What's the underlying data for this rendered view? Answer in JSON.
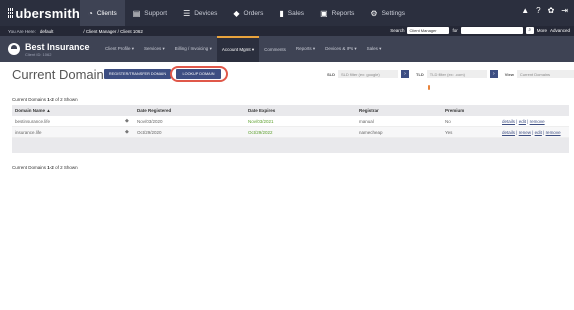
{
  "app": {
    "name": "ubersmith"
  },
  "topnav": {
    "items": [
      {
        "label": "Clients",
        "icon": "gauge-icon",
        "active": true
      },
      {
        "label": "Support",
        "icon": "support-icon",
        "active": false
      },
      {
        "label": "Devices",
        "icon": "devices-icon",
        "active": false
      },
      {
        "label": "Orders",
        "icon": "tag-icon",
        "active": false
      },
      {
        "label": "Sales",
        "icon": "bar-chart-icon",
        "active": false
      },
      {
        "label": "Reports",
        "icon": "report-icon",
        "active": false
      },
      {
        "label": "Settings",
        "icon": "gear-icon",
        "active": false
      }
    ]
  },
  "crumbbar": {
    "you_are_here_label": "You Are Here:",
    "you_are_here_value": "default",
    "path": "/ Client Manager / Client 1062",
    "search_label": "Search",
    "search_scope": "Client Manager",
    "for_label": "for",
    "more_label": "More",
    "advanced_label": "Advanced"
  },
  "client": {
    "name": "Best Insurance",
    "id_label": "Client ID: 1062"
  },
  "clientnav": {
    "items": [
      {
        "label": "Client Profile ▾",
        "active": false
      },
      {
        "label": "Services ▾",
        "active": false
      },
      {
        "label": "Billing / Invoicing ▾",
        "active": false
      },
      {
        "label": "Account Mgmt ▾",
        "active": true
      },
      {
        "label": "Comments",
        "active": false
      },
      {
        "label": "Reports ▾",
        "active": false
      },
      {
        "label": "Devices & IPs ▾",
        "active": false
      },
      {
        "label": "Sales ▾",
        "active": false
      }
    ]
  },
  "page": {
    "title": "Current Domains",
    "register_button": "REGISTER/TRANSFER DOMAIN",
    "lookup_button": "LOOKUP DOMAIN",
    "sld_label": "SLD",
    "sld_placeholder": "SLD filter (ex: google)",
    "tld_label": "TLD",
    "tld_placeholder": "TLD filter (ex: .com)",
    "view_label": "View",
    "view_value": "Current Domains",
    "go_glyph": "›",
    "count_prefix": "Current Domains",
    "count_range": "1-2",
    "count_suffix": "of 2 Shown"
  },
  "table": {
    "headers": [
      "Domain Name ▲",
      "Date Registered",
      "Date Expires",
      "Registrar",
      "Premium"
    ],
    "rows": [
      {
        "domain": "bestinsurance.life",
        "registered": "Nov/03/2020",
        "expires": "Nov/03/2021",
        "registrar": "manual",
        "premium": "No",
        "actions": [
          "details",
          "edit",
          "remove"
        ]
      },
      {
        "domain": "insurance.life",
        "registered": "Oct/29/2020",
        "expires": "Oct/29/2022",
        "registrar": "namecheap",
        "premium": "Yes",
        "actions": [
          "details",
          "renew",
          "edit",
          "remove"
        ]
      }
    ]
  },
  "colors": {
    "topbar": "#2b2f3e",
    "clientbar": "#3e4354",
    "button": "#3d4e82",
    "accent_ring": "#e0584a",
    "expires_green": "#5a9e2a"
  }
}
